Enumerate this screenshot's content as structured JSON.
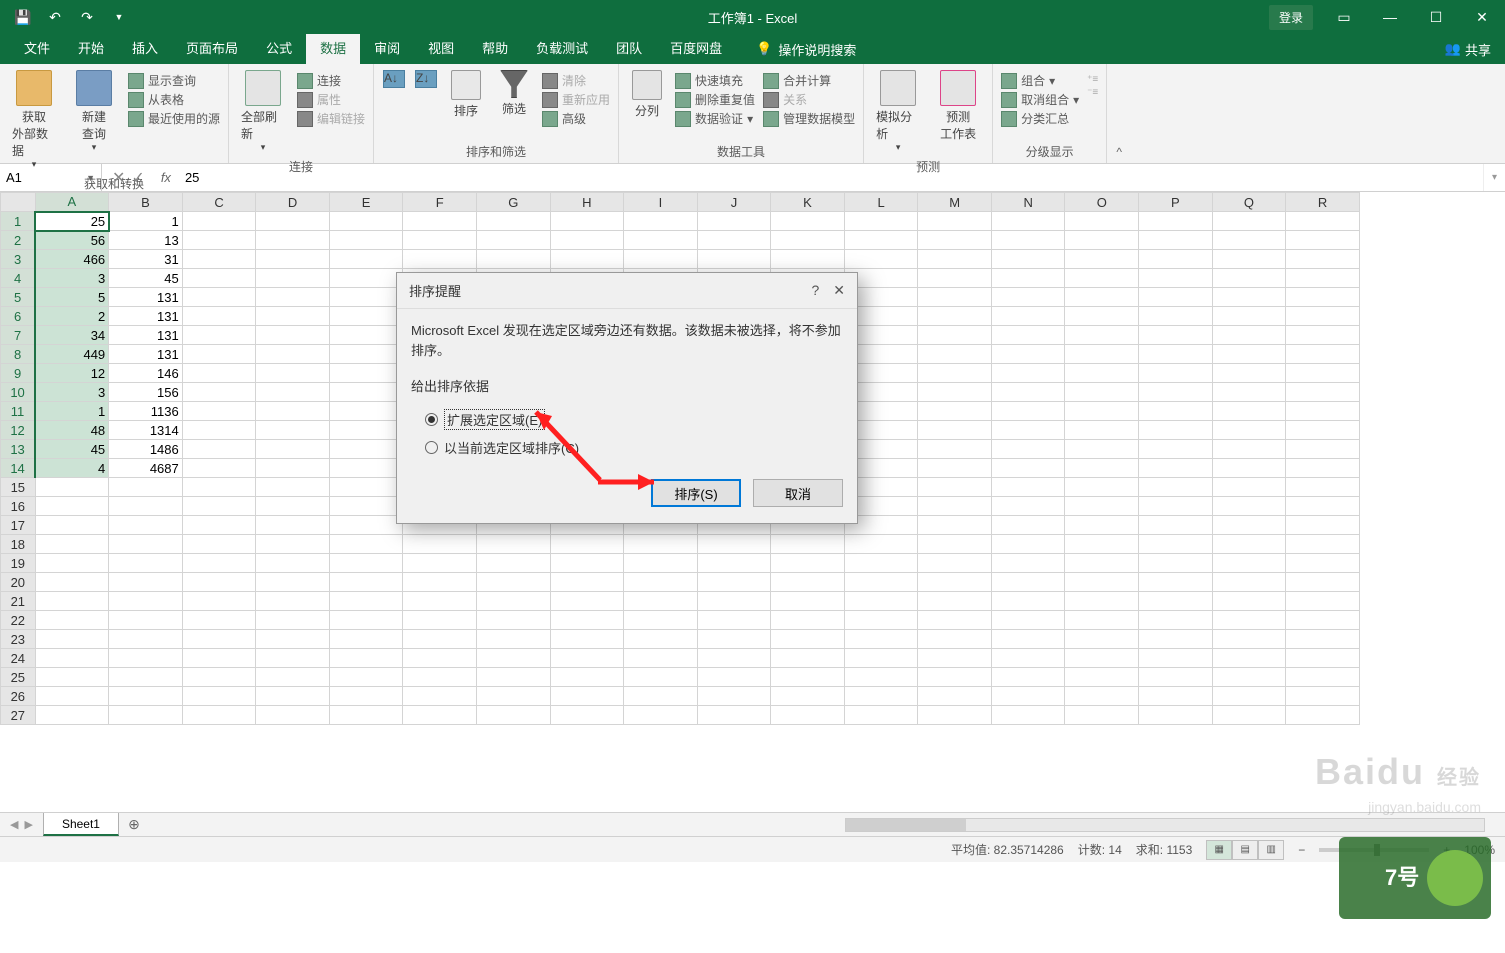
{
  "titlebar": {
    "title": "工作簿1 - Excel",
    "login": "登录"
  },
  "tabs": {
    "file": "文件",
    "home": "开始",
    "insert": "插入",
    "layout": "页面布局",
    "formulas": "公式",
    "data": "数据",
    "review": "审阅",
    "view": "视图",
    "help": "帮助",
    "loadtest": "负载测试",
    "team": "团队",
    "baidu": "百度网盘",
    "tellme": "操作说明搜索",
    "share": "共享"
  },
  "ribbon": {
    "g1": {
      "btn1a": "获取",
      "btn1b": "外部数据",
      "btn2a": "新建",
      "btn2b": "查询",
      "i1": "显示查询",
      "i2": "从表格",
      "i3": "最近使用的源",
      "label": "获取和转换"
    },
    "g2": {
      "btn": "全部刷新",
      "i1": "连接",
      "i2": "属性",
      "i3": "编辑链接",
      "label": "连接"
    },
    "g3": {
      "btn": "排序",
      "btn2": "筛选",
      "i1": "清除",
      "i2": "重新应用",
      "i3": "高级",
      "label": "排序和筛选"
    },
    "g4": {
      "btn": "分列",
      "i1": "快速填充",
      "i2": "删除重复值",
      "i3": "数据验证",
      "i4": "合并计算",
      "i5": "关系",
      "i6": "管理数据模型",
      "label": "数据工具"
    },
    "g5": {
      "btn1": "模拟分析",
      "btn2a": "预测",
      "btn2b": "工作表",
      "label": "预测"
    },
    "g6": {
      "i1": "组合",
      "i2": "取消组合",
      "i3": "分类汇总",
      "label": "分级显示"
    }
  },
  "namebox": "A1",
  "formula_value": "25",
  "columns": [
    "A",
    "B",
    "C",
    "D",
    "E",
    "F",
    "G",
    "H",
    "I",
    "J",
    "K",
    "L",
    "M",
    "N",
    "O",
    "P",
    "Q",
    "R"
  ],
  "rows_header": [
    1,
    2,
    3,
    4,
    5,
    6,
    7,
    8,
    9,
    10,
    11,
    12,
    13,
    14,
    15,
    16,
    17,
    18,
    19,
    20,
    21,
    22,
    23,
    24,
    25,
    26,
    27
  ],
  "data": {
    "A": [
      25,
      56,
      466,
      3,
      5,
      2,
      34,
      449,
      12,
      3,
      1,
      48,
      45,
      4
    ],
    "B": [
      1,
      13,
      31,
      45,
      131,
      131,
      131,
      131,
      146,
      156,
      1136,
      1314,
      1486,
      4687
    ]
  },
  "dialog": {
    "title": "排序提醒",
    "message": "Microsoft Excel 发现在选定区域旁边还有数据。该数据未被选择，将不参加排序。",
    "section": "给出排序依据",
    "opt1": "扩展选定区域(E)",
    "opt2": "以当前选定区域排序(C)",
    "ok": "排序(S)",
    "cancel": "取消"
  },
  "sheet": {
    "name": "Sheet1"
  },
  "status": {
    "avg_label": "平均值:",
    "avg": "82.35714286",
    "count_label": "计数:",
    "count": "14",
    "sum_label": "求和:",
    "sum": "1153",
    "zoom": "100%"
  },
  "watermark": {
    "brand": "Baidu",
    "sub": "经验",
    "url": "jingyan.baidu.com"
  }
}
